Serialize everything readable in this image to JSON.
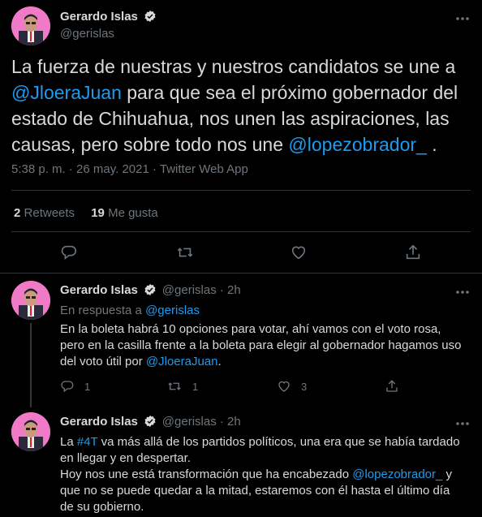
{
  "main_tweet": {
    "author_name": "Gerardo Islas",
    "handle": "@gerislas",
    "text_line1": "La fuerza de nuestras y nuestros candidatos se une a",
    "mention1": "@JloeraJuan",
    "text_line2": " para que sea el próximo gobernador del",
    "text_line3": "estado de Chihuahua, nos unen las aspiraciones, las",
    "text_line4": "causas, pero sobre todo nos une ",
    "mention2": "@lopezobrador_",
    "text_end": " .",
    "meta": "5:38 p. m. · 26 may. 2021 · Twitter Web App",
    "retweets_count": "2",
    "retweets_label": "Retweets",
    "likes_count": "19",
    "likes_label": "Me gusta"
  },
  "reply1": {
    "author_name": "Gerardo Islas",
    "handle_time": "@gerislas · 2h",
    "in_reply_prefix": "En respuesta a ",
    "in_reply_handle": "@gerislas",
    "line1": "En la boleta habrá 10 opciones para votar, ahí vamos con el voto rosa,",
    "line2": "pero en la casilla frente a la boleta para elegir al gobernador hagamos uso",
    "line3a": "del voto útil por ",
    "mention": "@JloeraJuan",
    "line3b": ".",
    "reply_count": "1",
    "retweet_count": "1",
    "like_count": "3"
  },
  "reply2": {
    "author_name": "Gerardo Islas",
    "handle_time": "@gerislas · 2h",
    "line1a": "La ",
    "hashtag": "#4T",
    "line1b": " va más allá de los partidos políticos, una era que se había tardado",
    "line2": "en llegar y en despertar.",
    "line3a": "Hoy nos une está transformación que ha encabezado ",
    "mention": "@lopezobrador_",
    "line3b": " y",
    "line4": "que no se puede quedar a la mitad, estaremos con él hasta el último día",
    "line5": "de su gobierno."
  },
  "colors": {
    "background": "#000000",
    "text": "#d9d9d9",
    "muted": "#6e767d",
    "link": "#1d9bf0",
    "divider": "#2f3336",
    "avatar_bg": "#f07ac8"
  },
  "icons": [
    "verified-icon",
    "more-icon",
    "reply-icon",
    "retweet-icon",
    "like-icon",
    "share-icon"
  ]
}
